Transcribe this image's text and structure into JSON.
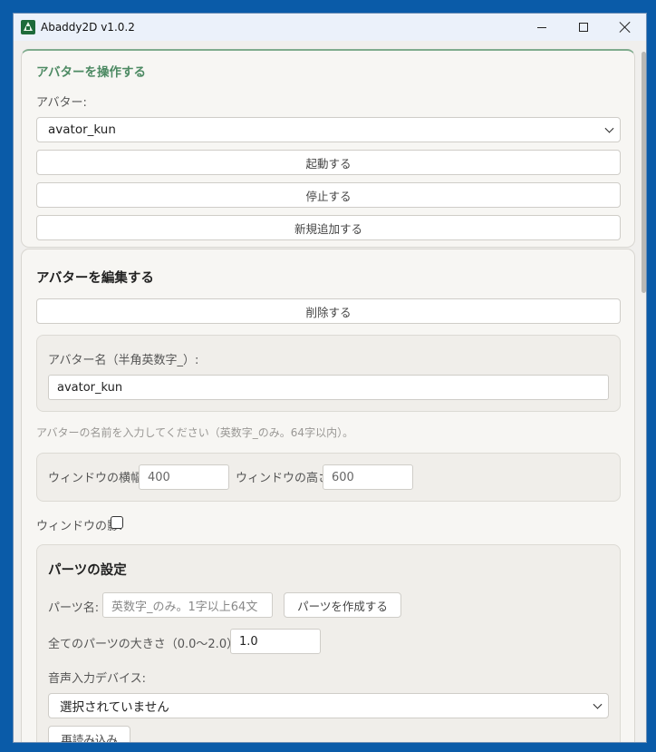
{
  "window": {
    "title": "Abaddy2D v1.0.2"
  },
  "operate": {
    "heading": "アバターを操作する",
    "avatar_label": "アバター:",
    "avatar_selected": "avator_kun",
    "start_button": "起動する",
    "stop_button": "停止する",
    "add_button": "新規追加する"
  },
  "edit": {
    "heading": "アバターを編集する",
    "delete_button": "削除する",
    "name_label": "アバター名（半角英数字_）:",
    "name_value": "avator_kun",
    "name_hint": "アバターの名前を入力してください（英数字_のみ。64字以内）。",
    "width_label": "ウィンドウの横幅:",
    "width_value": "400",
    "height_label": "ウィンドウの高さ:",
    "height_value": "600",
    "shadow_label": "ウィンドウの影:",
    "shadow_checked": false
  },
  "parts": {
    "heading": "パーツの設定",
    "name_label": "パーツ名:",
    "name_placeholder": "英数字_のみ。1字以上64文",
    "create_button": "パーツを作成する",
    "size_label": "全てのパーツの大きさ（0.0〜2.0）:",
    "size_value": "1.0",
    "audio_label": "音声入力デバイス:",
    "audio_selected": "選択されていません",
    "reload_button": "再読み込み"
  }
}
